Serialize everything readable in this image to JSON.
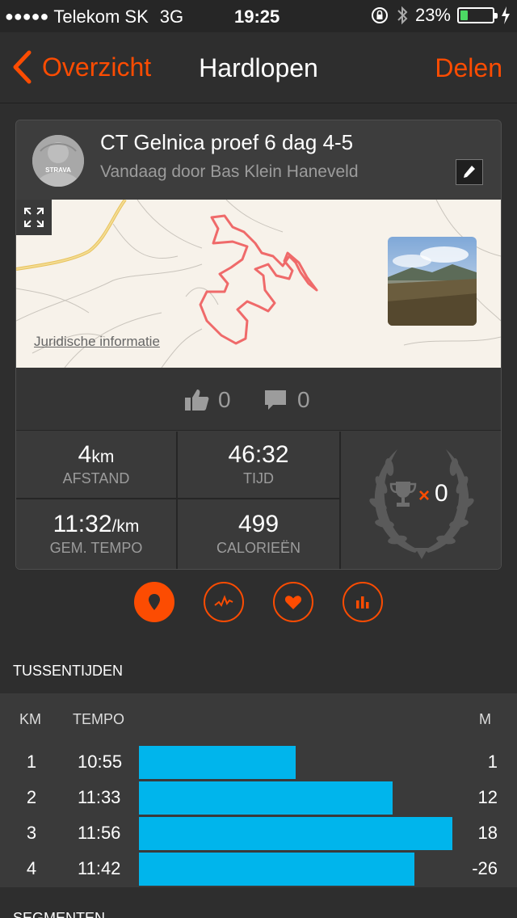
{
  "status_bar": {
    "signal_dots": "●●●●●",
    "carrier": "Telekom SK",
    "network": "3G",
    "time": "19:25",
    "battery_percent_text": "23%",
    "battery_level": 0.23,
    "icons": [
      "orientation-lock-icon",
      "bluetooth-icon",
      "battery-icon",
      "charging-bolt-icon"
    ]
  },
  "nav": {
    "back_label": "Overzicht",
    "title": "Hardlopen",
    "share_label": "Delen",
    "accent_color": "#fc4c02"
  },
  "activity": {
    "title": "CT Gelnica proef 6 dag 4-5",
    "subtitle": "Vandaag door Bas Klein Haneveld",
    "avatar_text": "STRAVA",
    "map_legal": "Juridische informatie",
    "kudos_count": "0",
    "comment_count": "0"
  },
  "stats": {
    "distance_value": "4",
    "distance_unit": "km",
    "distance_label": "AFSTAND",
    "time_value": "46:32",
    "time_label": "TIJD",
    "pace_value": "11:32",
    "pace_unit": "/km",
    "pace_label": "GEM. TEMPO",
    "calories_value": "499",
    "calories_label": "CALORIEËN",
    "achievements_times": "×",
    "achievements_count": "0"
  },
  "tabs": [
    {
      "name": "map-pin-icon",
      "active": true
    },
    {
      "name": "pace-chart-icon",
      "active": false
    },
    {
      "name": "heart-icon",
      "active": false
    },
    {
      "name": "bar-chart-icon",
      "active": false
    }
  ],
  "splits": {
    "section_title": "TUSSENTIJDEN",
    "col_km": "KM",
    "col_pace": "TEMPO",
    "col_elev": "M",
    "bar_color": "#00b5ec",
    "rows": [
      {
        "km": "1",
        "pace": "10:55",
        "elev": "1",
        "bar_fraction": 0.5
      },
      {
        "km": "2",
        "pace": "11:33",
        "elev": "12",
        "bar_fraction": 0.81
      },
      {
        "km": "3",
        "pace": "11:56",
        "elev": "18",
        "bar_fraction": 1.0
      },
      {
        "km": "4",
        "pace": "11:42",
        "elev": "-26",
        "bar_fraction": 0.88
      }
    ]
  },
  "segments": {
    "section_title": "SEGMENTEN"
  }
}
